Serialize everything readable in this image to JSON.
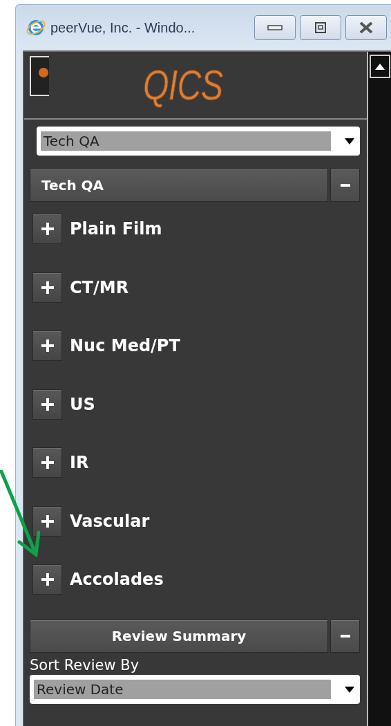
{
  "window": {
    "title": "peerVue, Inc. - Windo..."
  },
  "logo": {
    "text": "QICS"
  },
  "category_select": {
    "value": "Tech QA"
  },
  "section": {
    "title": "Tech QA",
    "expanded": true,
    "items": [
      {
        "label": "Plain Film",
        "expanded": false
      },
      {
        "label": "CT/MR",
        "expanded": false
      },
      {
        "label": "Nuc Med/PT",
        "expanded": false
      },
      {
        "label": "US",
        "expanded": false
      },
      {
        "label": "IR",
        "expanded": false
      },
      {
        "label": "Vascular",
        "expanded": false
      },
      {
        "label": "Accolades",
        "expanded": false
      }
    ]
  },
  "review_summary": {
    "title": "Review Summary",
    "expanded": true,
    "sort_label": "Sort Review By",
    "sort_select": {
      "value": "Review Date"
    }
  }
}
